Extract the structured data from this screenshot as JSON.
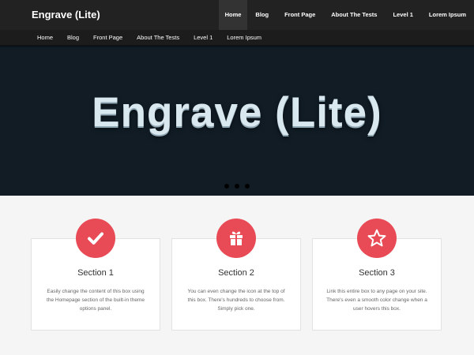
{
  "site": {
    "title": "Engrave (Lite)"
  },
  "main_nav": [
    {
      "label": "Home",
      "active": true
    },
    {
      "label": "Blog",
      "active": false
    },
    {
      "label": "Front Page",
      "active": false
    },
    {
      "label": "About The Tests",
      "active": false
    },
    {
      "label": "Level 1",
      "active": false
    },
    {
      "label": "Lorem Ipsum",
      "active": false
    }
  ],
  "sub_nav": [
    {
      "label": "Home"
    },
    {
      "label": "Blog"
    },
    {
      "label": "Front Page"
    },
    {
      "label": "About The Tests"
    },
    {
      "label": "Level 1"
    },
    {
      "label": "Lorem Ipsum"
    }
  ],
  "hero": {
    "title": "Engrave (Lite)",
    "slides": 3,
    "active_slide": 1
  },
  "sections": [
    {
      "icon": "check-icon",
      "title": "Section 1",
      "text": "Easily change the content of this box using the Homepage section of the built-in theme options panel."
    },
    {
      "icon": "gift-icon",
      "title": "Section 2",
      "text": "You can even change the icon at the top of this box. There's hundreds to choose from. Simply pick one."
    },
    {
      "icon": "star-icon",
      "title": "Section 3",
      "text": "Link this entire box to any page on your site. There's even a smooth color change when a user hovers this box."
    }
  ],
  "colors": {
    "accent": "#e84b55",
    "header_bg": "#222222",
    "hero_bg": "#111c25"
  }
}
